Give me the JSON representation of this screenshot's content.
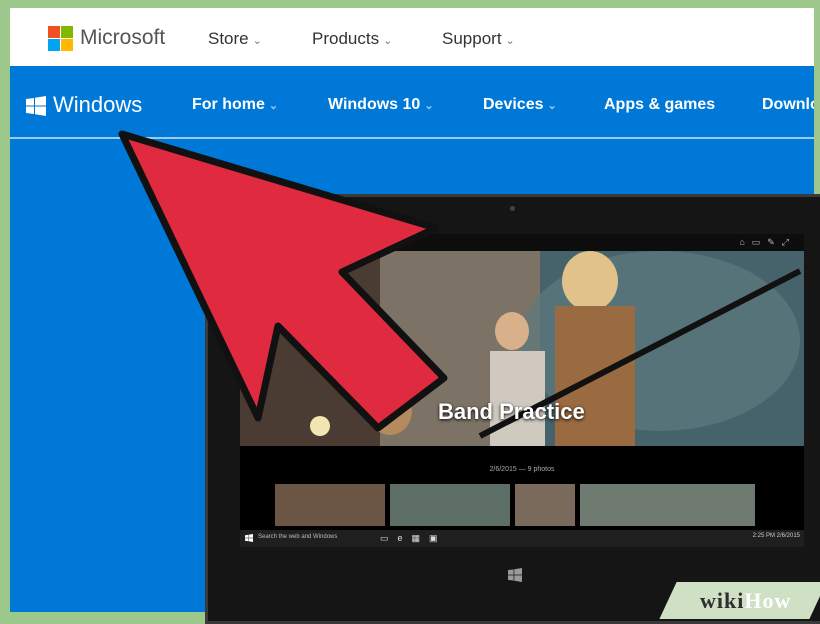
{
  "header": {
    "brand": "Microsoft",
    "nav": [
      {
        "label": "Store",
        "caret": "⌄"
      },
      {
        "label": "Products",
        "caret": "⌄"
      },
      {
        "label": "Support",
        "caret": "⌄"
      }
    ]
  },
  "windows_nav": {
    "brand": "Windows",
    "items": [
      {
        "label": "For home",
        "caret": "⌄"
      },
      {
        "label": "Windows 10",
        "caret": "⌄"
      },
      {
        "label": "Devices",
        "caret": "⌄"
      },
      {
        "label": "Apps & games",
        "caret": ""
      },
      {
        "label": "Downloa",
        "caret": ""
      }
    ]
  },
  "tablet_screen": {
    "album_title": "Band Practice",
    "album_meta": "2/6/2015 — 9 photos",
    "taskbar_search": "Search the web and Windows",
    "clock": "2:25 PM\n2/6/2015"
  },
  "watermark": {
    "wiki": "wiki",
    "how": "How"
  },
  "colors": {
    "windows_blue": "#0078d7",
    "arrow_red": "#e02a3f",
    "ms_red": "#f25022",
    "ms_green": "#7fba00",
    "ms_blue": "#00a4ef",
    "ms_yellow": "#ffb900"
  }
}
